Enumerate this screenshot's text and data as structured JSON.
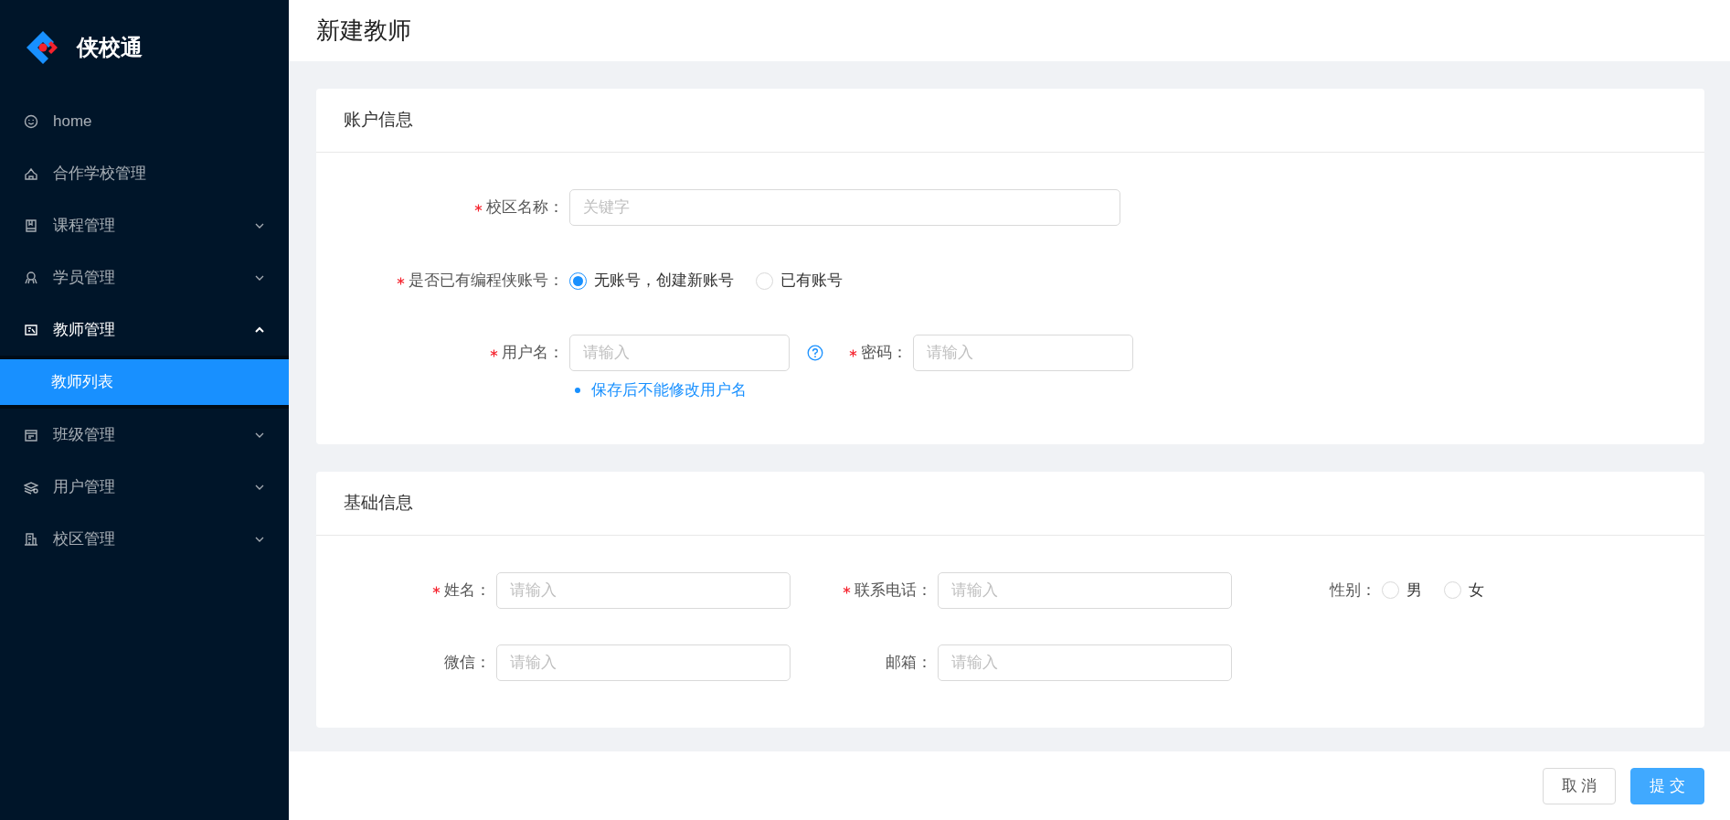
{
  "sidebar": {
    "logo": "侠校通",
    "items": [
      {
        "label": "home",
        "kind": "link",
        "selected": false
      },
      {
        "label": "合作学校管理",
        "kind": "link",
        "selected": false
      },
      {
        "label": "课程管理",
        "kind": "submenu",
        "expanded": false
      },
      {
        "label": "学员管理",
        "kind": "submenu",
        "expanded": false
      },
      {
        "label": "教师管理",
        "kind": "submenu",
        "expanded": true,
        "children": [
          {
            "label": "教师列表",
            "selected": true
          }
        ]
      },
      {
        "label": "班级管理",
        "kind": "submenu",
        "expanded": false
      },
      {
        "label": "用户管理",
        "kind": "submenu",
        "expanded": false
      },
      {
        "label": "校区管理",
        "kind": "submenu",
        "expanded": false
      }
    ]
  },
  "page_title": "新建教师",
  "account": {
    "title": "账户信息",
    "campus": {
      "label": "校区名称：",
      "required": true,
      "placeholder": "关键字"
    },
    "has_account": {
      "label": "是否已有编程侠账号：",
      "required": true,
      "options": [
        {
          "label": "无账号，创建新账号",
          "selected": true
        },
        {
          "label": "已有账号",
          "selected": false
        }
      ]
    },
    "username": {
      "label": "用户名：",
      "required": true,
      "placeholder": "请输入",
      "hint": "保存后不能修改用户名"
    },
    "password": {
      "label": "密码：",
      "required": true,
      "placeholder": "请输入"
    }
  },
  "basic": {
    "title": "基础信息",
    "name": {
      "label": "姓名：",
      "required": true,
      "placeholder": "请输入"
    },
    "phone": {
      "label": "联系电话：",
      "required": true,
      "placeholder": "请输入"
    },
    "gender": {
      "label": "性别：",
      "required": false,
      "options": [
        {
          "label": "男",
          "selected": false
        },
        {
          "label": "女",
          "selected": false
        }
      ]
    },
    "wechat": {
      "label": "微信：",
      "required": false,
      "placeholder": "请输入"
    },
    "email": {
      "label": "邮箱：",
      "required": false,
      "placeholder": "请输入"
    }
  },
  "footer_buttons": [
    {
      "label": "取 消",
      "kind": "default"
    },
    {
      "label": "提 交",
      "kind": "primary"
    }
  ]
}
